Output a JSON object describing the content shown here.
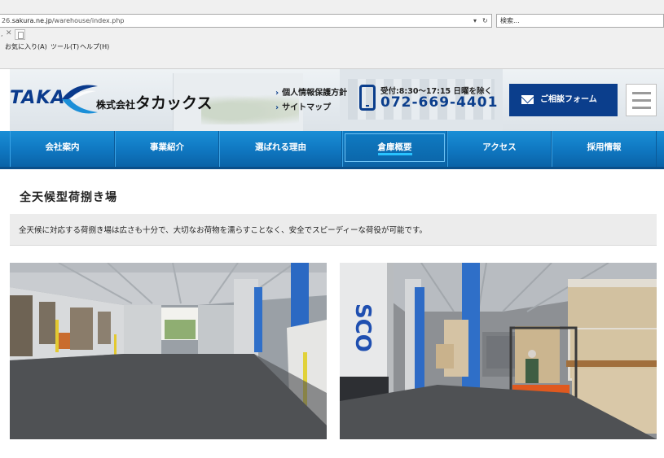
{
  "browser": {
    "url_prefix": "26.",
    "url_host": "sakura.ne.jp",
    "url_path": "/warehouse/index.php",
    "search_placeholder": "検索...",
    "menu": [
      "お気に入り(A)",
      "ツール(T)",
      "ヘルプ(H)"
    ]
  },
  "header": {
    "logo_text": "TAKA",
    "company_prefix": "株式会社",
    "company_name": "タカックス",
    "links": [
      "個人情報保護方針",
      "サイトマップ"
    ],
    "hours": "受付:8:30〜17:15 日曜を除く",
    "phone": "072-669-4401",
    "consult_label": "ご相談フォーム",
    "colors": {
      "brand": "#0b3e8c",
      "nav": "#0f76c0"
    }
  },
  "nav": {
    "items": [
      "会社案内",
      "事業紹介",
      "選ばれる理由",
      "倉庫概要",
      "アクセス",
      "採用情報"
    ],
    "active_index": 3
  },
  "main": {
    "title": "全天候型荷捌き場",
    "description": "全天候に対応する荷捌き場は広さも十分で、大切なお荷物を濡らすことなく、安全でスピーディーな荷役が可能です。"
  },
  "photos": {
    "photo1_name": "loading-dock-photo",
    "photo2_name": "forklift-photo",
    "container_text": "SCO"
  }
}
